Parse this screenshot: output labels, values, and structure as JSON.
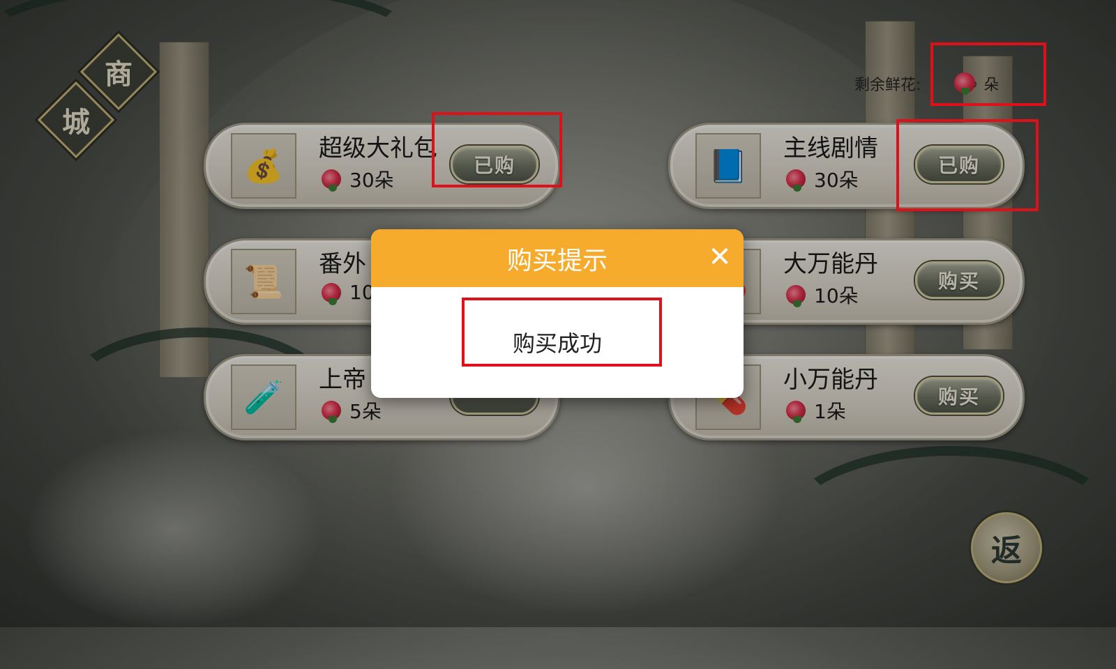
{
  "shop_title": [
    "商",
    "城"
  ],
  "flower_counter": {
    "label": "剩余鲜花:",
    "value": "∞",
    "unit": "朵",
    "icon": "rose-icon"
  },
  "items": [
    {
      "name": "超级大礼包",
      "price": "30朵",
      "button": "已购",
      "icon": "money-bag-icon",
      "glyph": "💰"
    },
    {
      "name": "主线剧情",
      "price": "30朵",
      "button": "已购",
      "icon": "book-icon",
      "glyph": "📘"
    },
    {
      "name": "番外",
      "price": "10",
      "button": "",
      "icon": "scroll-icon",
      "glyph": "📜"
    },
    {
      "name": "大万能丹",
      "price": "10朵",
      "button": "购买",
      "icon": "pill-icon",
      "glyph": "💊"
    },
    {
      "name": "上帝",
      "price": "5朵",
      "button": "",
      "icon": "potion-icon",
      "glyph": "🧪"
    },
    {
      "name": "小万能丹",
      "price": "1朵",
      "button": "购买",
      "icon": "pill-icon",
      "glyph": "💊"
    }
  ],
  "return_button": {
    "label": "返"
  },
  "dialog": {
    "title": "购买提示",
    "message": "购买成功",
    "close_icon": "close-icon"
  }
}
